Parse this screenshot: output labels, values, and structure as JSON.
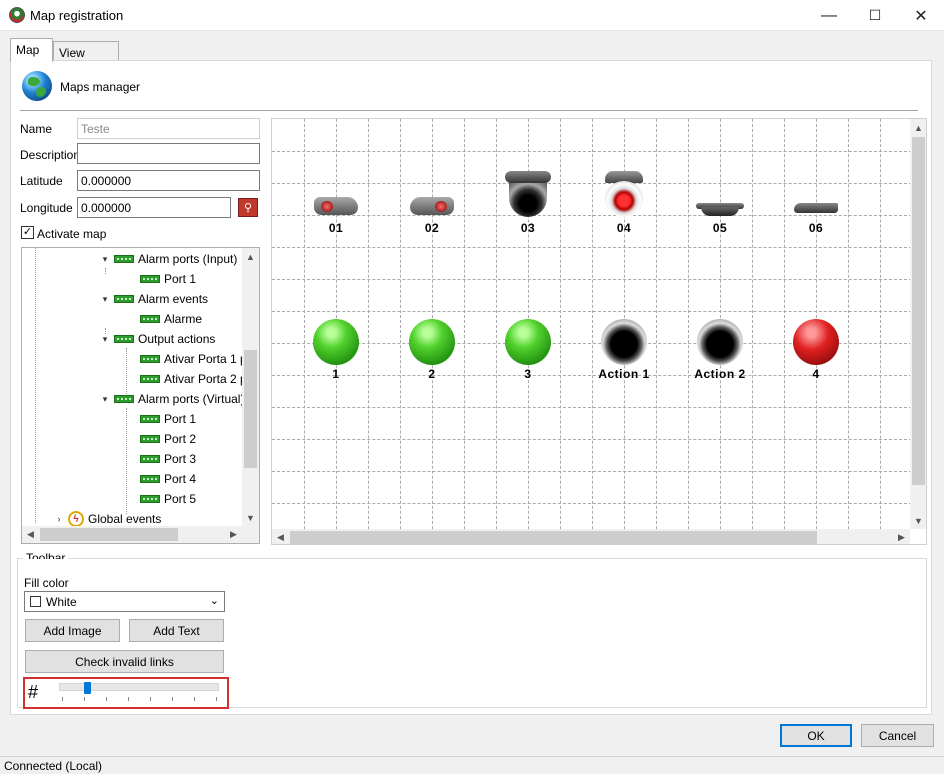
{
  "window": {
    "title": "Map registration",
    "minimize": "—",
    "maximize": "☐",
    "close": "✕"
  },
  "tabs": [
    {
      "label": "Map",
      "active": true
    },
    {
      "label": "View Rights",
      "active": false
    }
  ],
  "header": {
    "title": "Maps manager",
    "icon": "globe-icon"
  },
  "form": {
    "name_label": "Name",
    "name_value": "Teste",
    "description_label": "Description",
    "description_value": "",
    "latitude_label": "Latitude",
    "latitude_value": "0.000000",
    "longitude_label": "Longitude",
    "longitude_value": "0.000000",
    "activate_label": "Activate map",
    "activate_checked": true
  },
  "tree": {
    "nodes": [
      {
        "label": "Alarm ports (Input)",
        "expanded": true,
        "level": 0
      },
      {
        "label": "Port 1",
        "level": 1
      },
      {
        "label": "Alarm events",
        "expanded": true,
        "level": 0
      },
      {
        "label": "Alarme",
        "level": 1
      },
      {
        "label": "Output actions",
        "expanded": true,
        "level": 0
      },
      {
        "label": "Ativar Porta 1 p",
        "level": 1
      },
      {
        "label": "Ativar Porta 2 p",
        "level": 1
      },
      {
        "label": "Alarm ports (Virtual)",
        "expanded": true,
        "level": 0
      },
      {
        "label": "Port 1",
        "level": 1
      },
      {
        "label": "Port 2",
        "level": 1
      },
      {
        "label": "Port 3",
        "level": 1
      },
      {
        "label": "Port 4",
        "level": 1
      },
      {
        "label": "Port 5",
        "level": 1
      },
      {
        "label": "Global events",
        "level": -1
      }
    ]
  },
  "map": {
    "cameras": [
      {
        "label": "01",
        "type": "bullet"
      },
      {
        "label": "02",
        "type": "bullet"
      },
      {
        "label": "03",
        "type": "dome-dark"
      },
      {
        "label": "04",
        "type": "dome-red"
      },
      {
        "label": "05",
        "type": "flat"
      },
      {
        "label": "06",
        "type": "flat"
      }
    ],
    "indicators": [
      {
        "label": "1",
        "color": "green"
      },
      {
        "label": "2",
        "color": "green"
      },
      {
        "label": "3",
        "color": "green"
      },
      {
        "label": "Action 1",
        "color": "gray"
      },
      {
        "label": "Action 2",
        "color": "gray"
      },
      {
        "label": "4",
        "color": "red"
      }
    ]
  },
  "toolbar": {
    "group_label": "Toolbar",
    "fill_color_label": "Fill color",
    "fill_color_value": "White",
    "add_image": "Add Image",
    "add_text": "Add Text",
    "check_links": "Check invalid links",
    "grid_slider_level": 0.12
  },
  "dialog": {
    "ok": "OK",
    "cancel": "Cancel"
  },
  "status": {
    "text": "Connected (Local)"
  },
  "colors": {
    "accent": "#0078d7",
    "highlight": "#d32f2f",
    "port_green": "#2e9b2e"
  }
}
